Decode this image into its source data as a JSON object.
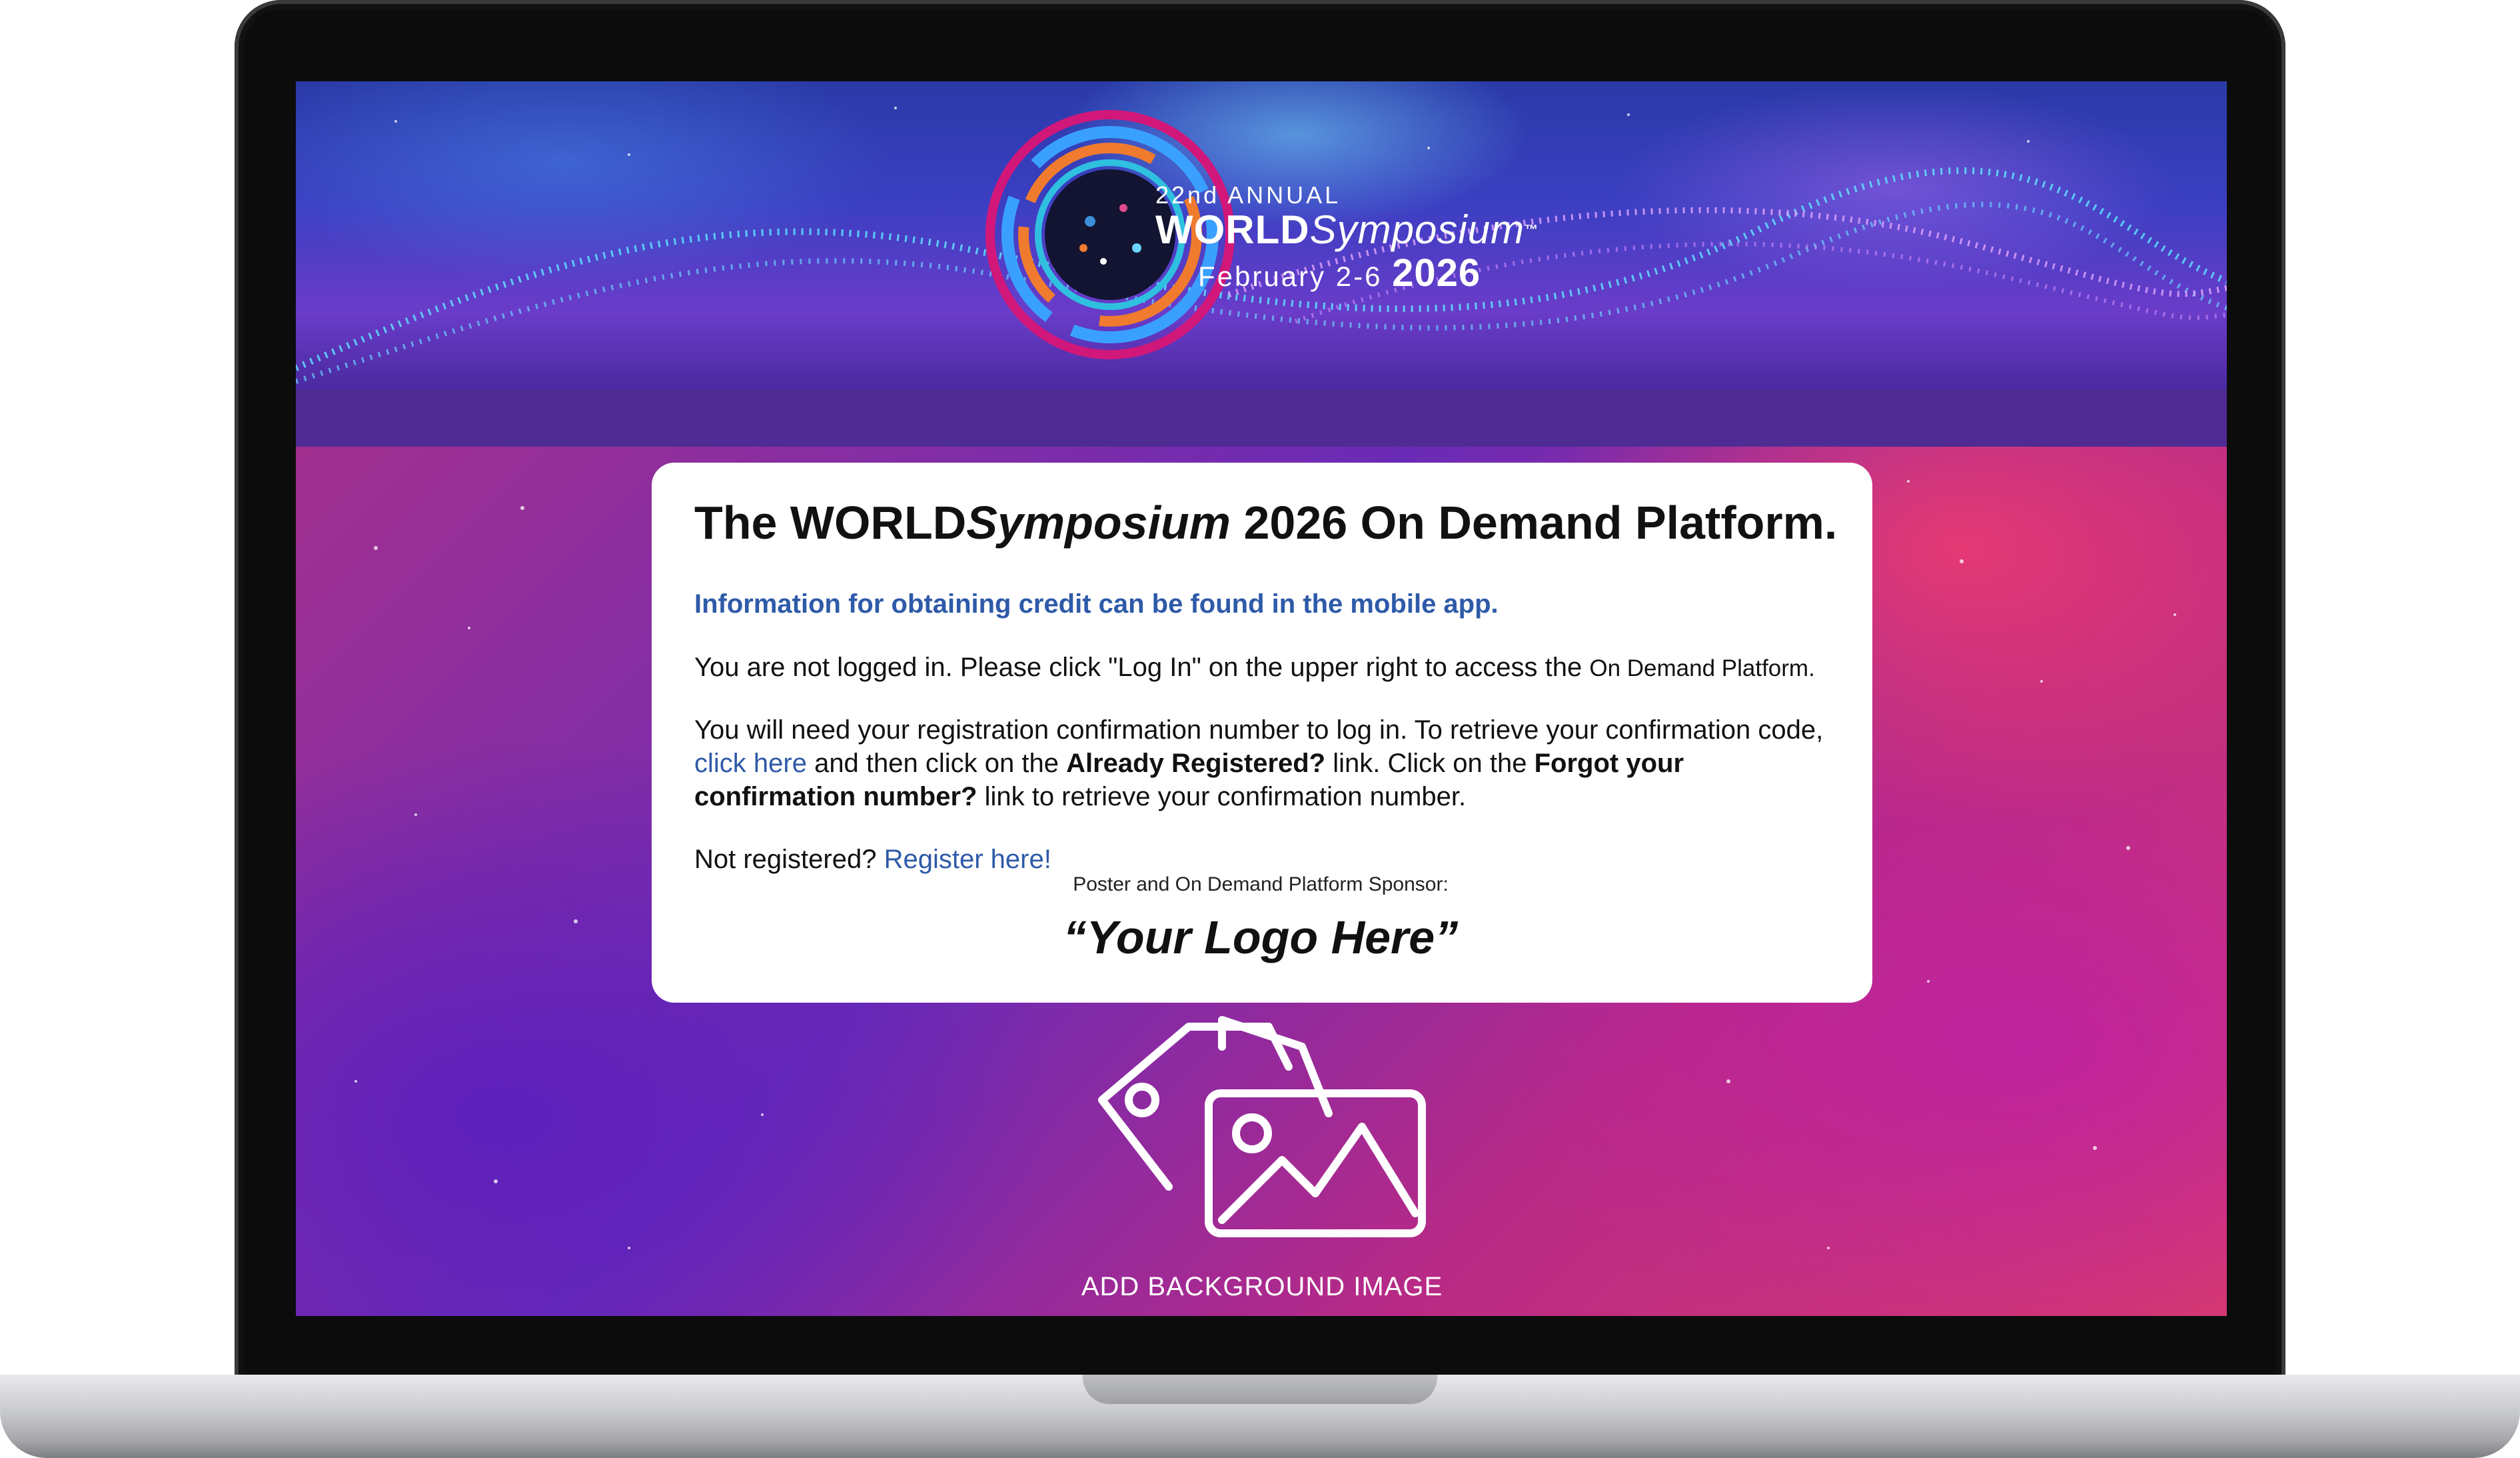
{
  "logo": {
    "annual": "22nd ANNUAL",
    "world_bold": "WORLD",
    "world_italic": "Symposium",
    "trademark": "™",
    "dates": "February 2-6",
    "year": "2026"
  },
  "card": {
    "title_prefix": "The WORLD",
    "title_italic": "Symposium",
    "title_suffix": " 2026 On Demand Platform.",
    "info": "Information for obtaining credit can be found in the mobile app.",
    "not_logged_in": "You are not logged in. Please click \"Log In\" on the upper right to access the ",
    "not_logged_in_small": "On Demand Platform.",
    "retrieve_text": "You will need your registration confirmation number to log in. To retrieve your confirmation code, ",
    "click_here": "click here",
    "then_click": " and then click on the ",
    "already_registered": "Already Registered?",
    "link_click_forgot": " link. Click on the ",
    "forgot": "Forgot your confirmation number?",
    "link_retrieve": " link to retrieve your confirmation number.",
    "not_registered": "Not registered? ",
    "register_here": "Register here!",
    "sponsor_label": "Poster and On Demand Platform Sponsor:",
    "sponsor_logo": "“Your Logo Here”"
  },
  "background": {
    "add_image_label": "ADD BACKGROUND IMAGE",
    "icon": "images-icon"
  },
  "colors": {
    "link": "#2e5aa8",
    "strip": "#4f2c93",
    "banner": "#3b3fc2"
  }
}
